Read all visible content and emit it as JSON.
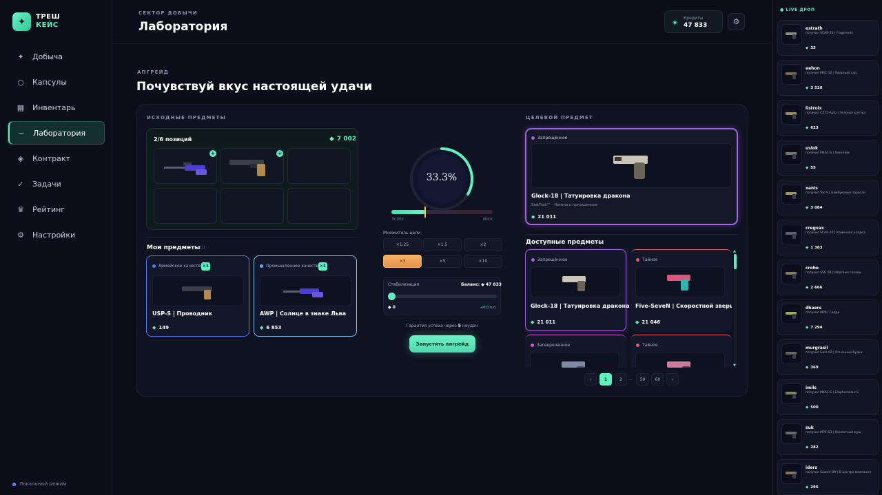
{
  "logo": {
    "line1": "ТРЕШ",
    "line2": "КЕЙС",
    "icon": "sparkle-icon"
  },
  "nav": [
    {
      "label": "Добыча",
      "icon": "sparkle-icon"
    },
    {
      "label": "Капсулы",
      "icon": "circle-icon"
    },
    {
      "label": "Инвентарь",
      "icon": "grid-icon"
    },
    {
      "label": "Лаборатория",
      "icon": "flask-icon",
      "active": true
    },
    {
      "label": "Контракт",
      "icon": "diamond-icon"
    },
    {
      "label": "Задачи",
      "icon": "check-icon"
    },
    {
      "label": "Рейтинг",
      "icon": "crown-icon"
    },
    {
      "label": "Настройки",
      "icon": "gear-icon"
    }
  ],
  "local_mode": "Локальный режим",
  "header": {
    "eyebrow": "СЕКТОР ДОБЫЧИ",
    "title": "Лаборатория",
    "credits_label": "Кредиты",
    "credits_value": "47 833"
  },
  "section": {
    "eyebrow": "АПГРЕЙД",
    "title": "Почувствуй вкус настоящей удачи"
  },
  "source": {
    "title": "ИСХОДНЫЕ ПРЕДМЕТЫ",
    "positions": "2/6 позиций",
    "total": "7 002",
    "filled_slots": [
      "awp",
      "usp"
    ]
  },
  "my_items": {
    "title": "Мои предметы",
    "page": "стр. 1/1",
    "items": [
      {
        "quality": "Армейское качество",
        "quality_color": "#4c7bf5",
        "name": "USP-S | Проводник",
        "price": "149",
        "badge": "×1",
        "border": "#4c7bf5",
        "gun": "usp"
      },
      {
        "quality": "Промышленное качество",
        "quality_color": "#6aa8f5",
        "name": "AWP | Солнце в знаке Льва",
        "price": "6 853",
        "badge": "×1",
        "border": "#7cc4f0",
        "gun": "awp"
      }
    ]
  },
  "center": {
    "chance": "33.3%",
    "chance_value": 0.333,
    "label_success": "УСПЕХ",
    "label_risk": "РИСК",
    "multiplier_label": "Множитель цели",
    "multipliers": [
      "×1.25",
      "×1.5",
      "×2",
      "×3",
      "×5",
      "×10"
    ],
    "active_multiplier": "×3",
    "stab_label": "Стабилизация",
    "stab_balance": "Баланс: ◆ 47 833",
    "stab_value": "◆ 0",
    "stab_pp": "+0.0 п.п.",
    "guarantee_pre": "Гарантия успеха через ",
    "guarantee_num": "5",
    "guarantee_post": " неудач",
    "launch": "Запустить апгрейд"
  },
  "target": {
    "title": "ЦЕЛЕВОЙ ПРЕДМЕТ",
    "quality": "Запрещённое",
    "name": "Glock-18 | Татуировка дракона",
    "sub": "StatTrak™ · Немного поношенное",
    "price": "21 011"
  },
  "available": {
    "title": "Доступные предметы",
    "page": "стр. 1/60",
    "items": [
      {
        "quality": "Запрещённое",
        "qcolor": "#a364e8",
        "name": "Glock-18 | Татуировка дракона",
        "price": "21 011",
        "border": "#a364e8",
        "gun": "glock"
      },
      {
        "quality": "Тайное",
        "qcolor": "#e8566b",
        "name": "Five-SeveN | Скоростной зверь",
        "price": "21 046",
        "border": "#e8566b",
        "gun": "fiveseven"
      },
      {
        "quality": "Засекреченное",
        "qcolor": "#d654c9",
        "name": "",
        "price": "",
        "border": "#d654c9",
        "gun": "pistol"
      },
      {
        "quality": "Тайное",
        "qcolor": "#e8566b",
        "name": "",
        "price": "",
        "border": "#e8566b",
        "gun": "pink"
      }
    ]
  },
  "pagination": [
    "‹",
    "1",
    "2",
    "…",
    "59",
    "60",
    "›"
  ],
  "live": {
    "title": "● LIVE ДРОП",
    "drops": [
      {
        "user": "estrath",
        "item": "получил SCAR-20 | Fragments",
        "price": "33"
      },
      {
        "user": "eehon",
        "item": "получил MAC-10 | Ядерный сад",
        "price": "3 516"
      },
      {
        "user": "listroix",
        "item": "получил CZ75-Auto | Зеленая клетка",
        "price": "623"
      },
      {
        "user": "uslok",
        "item": "получил M4A1-S | Rose Hex",
        "price": "55"
      },
      {
        "user": "xanis",
        "item": "получил Tec-9 | Бамбуковые заросли",
        "price": "3 084"
      },
      {
        "user": "cregvax",
        "item": "получил SCAR-20 | Каменная кладка",
        "price": "1 383"
      },
      {
        "user": "crohe",
        "item": "получил SSG 08 | Мёртвые головы",
        "price": "2 666"
      },
      {
        "user": "dhaers",
        "item": "получил MP9 | Гидра",
        "price": "7 294"
      },
      {
        "user": "murgrasil",
        "item": "получил Galil AR | Огненные будки",
        "price": "369"
      },
      {
        "user": "imils",
        "item": "получил M4A1-S | Emphorosaur-S",
        "price": "500"
      },
      {
        "user": "zuk",
        "item": "получил MP5-SD | Кислотный душ",
        "price": "282"
      },
      {
        "user": "iders",
        "item": "получил Sawed-Off | В центре внимания",
        "price": "295"
      }
    ]
  }
}
